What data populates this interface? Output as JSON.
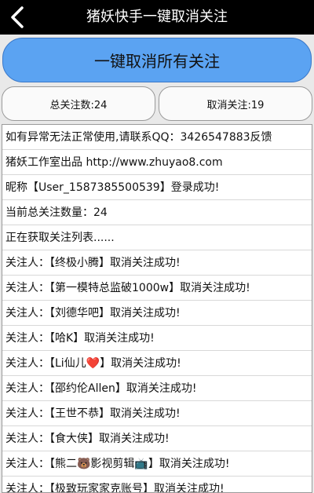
{
  "header": {
    "title": "猪妖快手一键取消关注",
    "back_icon": "back-chevron-icon"
  },
  "main_button": {
    "label": "一键取消所有关注"
  },
  "stats": {
    "total_label": "总关注数:24",
    "cancelled_label": "取消关注:19"
  },
  "log": {
    "lines": [
      "如有异常无法正常使用,请联系QQ：3426547883反馈",
      "猪妖工作室出品 http://www.zhuyao8.com",
      "昵称【User_1587385500539】登录成功!",
      "当前总关注数量：24",
      "正在获取关注列表......",
      "关注人：【终极小腾】取消关注成功!",
      "关注人：【第一模特总监破1000w】取消关注成功!",
      "关注人：【刘德华吧】取消关注成功!",
      "关注人：【哈K】取消关注成功!",
      "关注人：【Li仙儿❤️】取消关注成功!",
      "关注人：【邵约伦Allen】取消关注成功!",
      "关注人：【王世不恭】取消关注成功!",
      "关注人：【食大侠】取消关注成功!",
      "关注人：【熊二🐻影视剪辑📺】取消关注成功!",
      "关注人：【极致玩家家克账号】取消关注成功!"
    ]
  }
}
